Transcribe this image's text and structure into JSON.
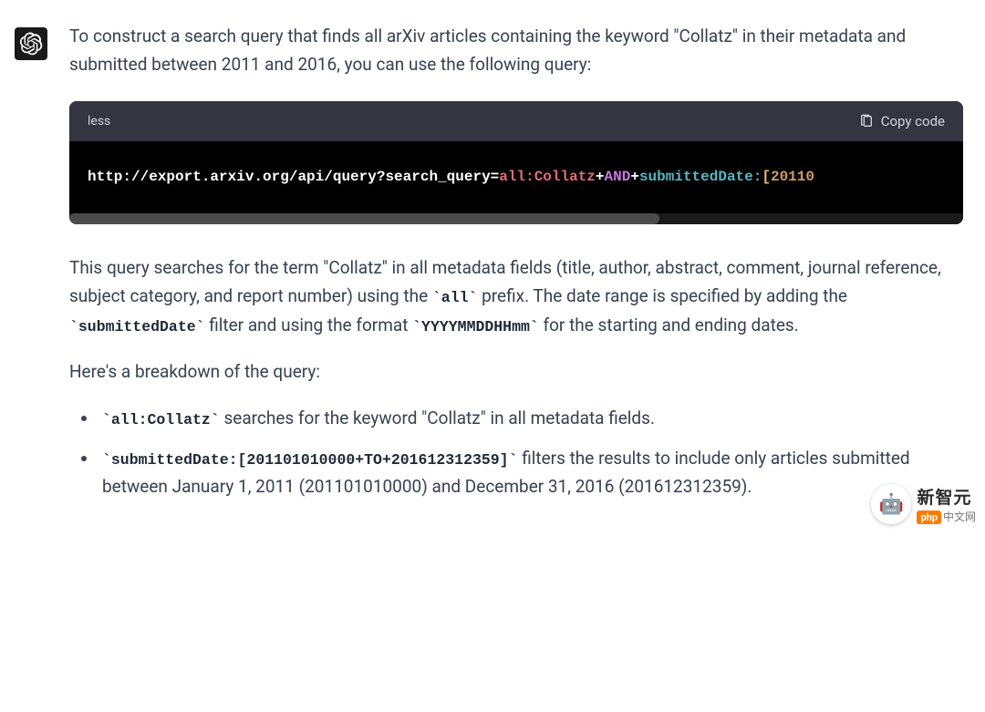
{
  "message": {
    "intro": "To construct a search query that finds all arXiv articles containing the keyword \"Collatz\" in their metadata and submitted between 2011 and 2016, you can use the following query:",
    "codeblock": {
      "language": "less",
      "copy_label": "Copy code",
      "url_base": "http://export.arxiv.org/api/query?",
      "param_key": "search_query",
      "equals": "=",
      "value1": "all:Collatz",
      "plus": "+",
      "operator": "AND",
      "field": "submittedDate:",
      "bracket": "[",
      "num": "20110"
    },
    "explanation": {
      "para1_pre": "This query searches for the term \"Collatz\" in all metadata fields (title, author, abstract, comment, journal reference, subject category, and report number) using the ",
      "code_all": "`all`",
      "para1_mid": " prefix. The date range is specified by adding the ",
      "code_submitted": "`submittedDate`",
      "para1_mid2": " filter and using the format ",
      "code_format": "`YYYYMMDDHHmm`",
      "para1_end": " for the starting and ending dates.",
      "breakdown_intro": "Here's a breakdown of the query:",
      "item1_code": "`all:Collatz`",
      "item1_text": " searches for the keyword \"Collatz\" in all metadata fields.",
      "item2_code": "`submittedDate:[201101010000+TO+201612312359]`",
      "item2_text": " filters the results to include only articles submitted between January 1, 2011 (201101010000) and December 31, 2016 (201612312359)."
    }
  },
  "watermark": {
    "brand": "新智元",
    "sub_badge": "php",
    "sub_text": "中文网"
  }
}
